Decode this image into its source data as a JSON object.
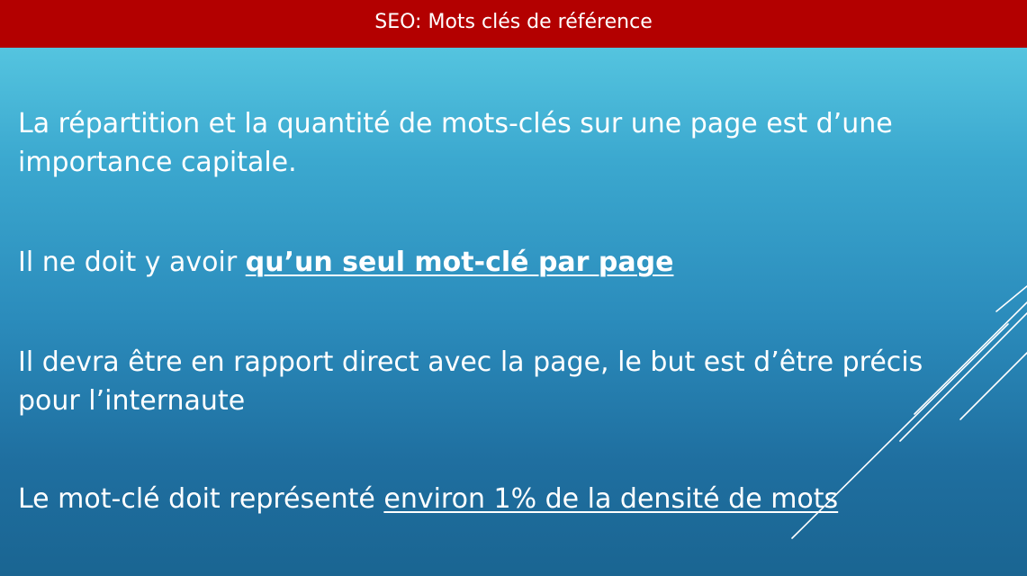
{
  "slide": {
    "title": "SEO: Mots clés de référence",
    "paragraphs": {
      "p1_line1": "La répartition et la quantité de mots-clés sur une page est d’une",
      "p1_line2": "importance capitale.",
      "p2_prefix": "Il ne doit y avoir ",
      "p2_emphasis": "qu’un seul mot-clé par page",
      "p3_line1": "Il devra être en rapport direct avec la page, le but est d’être précis",
      "p3_line2": "pour l’internaute",
      "p4_prefix": "Le mot-clé doit représenté ",
      "p4_emphasis": "environ 1% de la densité de mots"
    }
  },
  "colors": {
    "title_bar": "#b30000",
    "background_top": "#5fd0e6",
    "background_bottom": "#1a6592",
    "text": "#ffffff"
  }
}
